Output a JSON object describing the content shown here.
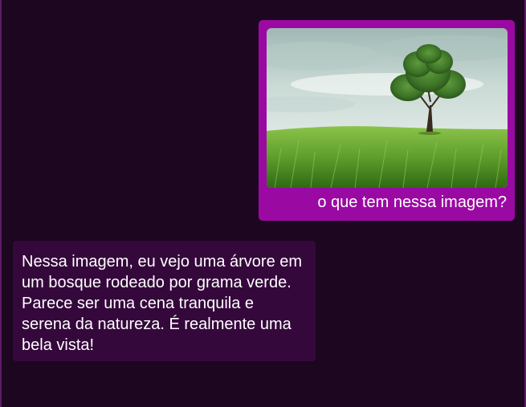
{
  "conversation": {
    "user_message": {
      "text": "o que tem nessa imagem?",
      "image": "tree-in-green-field-photo"
    },
    "bot_message": {
      "text": "Nessa imagem, eu vejo uma árvore em um bosque rodeado por grama verde. Parece ser uma cena tranquila e serena da natureza. É realmente uma bela vista!"
    }
  },
  "colors": {
    "background": "#1c0620",
    "user_bubble": "#9a0aa3",
    "bot_bubble": "#35083c",
    "text": "#ffffff"
  }
}
